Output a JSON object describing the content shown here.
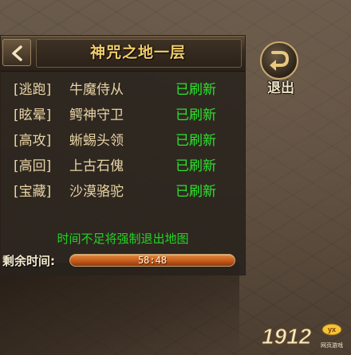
{
  "panel": {
    "title": "神咒之地一层",
    "bosses": [
      {
        "tag": "[逃跑]",
        "name": "牛魔侍从",
        "status": "已刷新"
      },
      {
        "tag": "[眩晕]",
        "name": "鳄神守卫",
        "status": "已刷新"
      },
      {
        "tag": "[高攻]",
        "name": "蜥蜴头领",
        "status": "已刷新"
      },
      {
        "tag": "[高回]",
        "name": "上古石傀",
        "status": "已刷新"
      },
      {
        "tag": "[宝藏]",
        "name": "沙漠骆驼",
        "status": "已刷新"
      }
    ],
    "warning": "时间不足将强制退出地图",
    "timer_label": "剩余时间:",
    "timer_value": "58:48"
  },
  "exit": {
    "label": "退出"
  },
  "logo": {
    "text": "1912",
    "badge": "yx",
    "sub": "网页游戏"
  },
  "colors": {
    "title": "#f2cc6a",
    "status": "#2ee22e",
    "warning": "#22d422",
    "text": "#e8d3a4",
    "timer_fill": "#c55a1c"
  },
  "icons": {
    "back": "chevron-left-icon",
    "exit": "exit-arrow-icon"
  }
}
